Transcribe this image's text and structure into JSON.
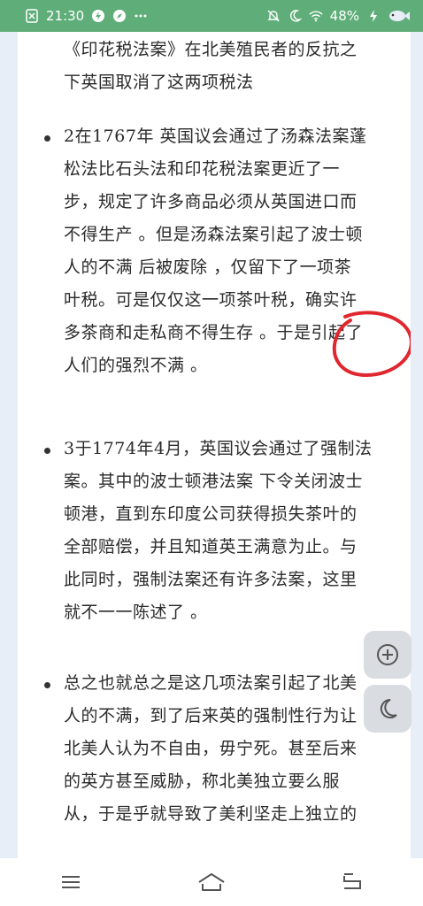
{
  "status_bar": {
    "time": "21:30",
    "battery": "48%",
    "icons": [
      "sim-off-icon",
      "bolt-icon",
      "compass-icon",
      "more-dots-icon",
      "bell-off-icon",
      "moon-icon",
      "wifi-icon",
      "battery-icon",
      "charging-icon",
      "fish-icon"
    ]
  },
  "article": {
    "intro_lines": [
      "《印花税法案》在北美殖民者的反抗之",
      "下英国取消了这两项税法"
    ],
    "items": [
      {
        "lines": [
          "2在1767年  英国议会通过了汤森法案蓬",
          "松法比石头法和印花税法案更近了一",
          "步，规定了许多商品必须从英国进口而",
          "不得生产  。但是汤森法案引起了波士顿",
          "人的不满  后被废除  ，仅留下了一项茶",
          "叶税。可是仅仅这一项茶叶税，确实许",
          "多茶商和走私商不得生存  。于是引起了",
          "人们的强烈不满  。"
        ]
      },
      {
        "lines": [
          "3于1774年4月，英国议会通过了强制法",
          "案。其中的波士顿港法案  下令关闭波士",
          "顿港，直到东印度公司获得损失茶叶的",
          "全部赔偿，并且知道英王满意为止。与",
          "此同时，强制法案还有许多法案，这里",
          "就不一一陈述了  。"
        ]
      },
      {
        "lines": [
          "总之也就总之是这几项法案引起了北美",
          "人的不满，到了后来英的强制性行为让",
          "北美人认为不自由，毋宁死。甚至后来",
          "的英方甚至威胁，称北美独立要么服",
          "从，于是乎就导致了美利坚走上独立的"
        ]
      }
    ]
  },
  "floating_buttons": {
    "zoom": "plus-circle-icon",
    "night_mode": "moon-icon"
  },
  "nav": {
    "buttons": [
      "menu-icon",
      "home-icon",
      "back-icon"
    ]
  },
  "colors": {
    "status_bar": "#5FAE79",
    "background": "#E7EEF7",
    "annotation": "#E0262E"
  }
}
